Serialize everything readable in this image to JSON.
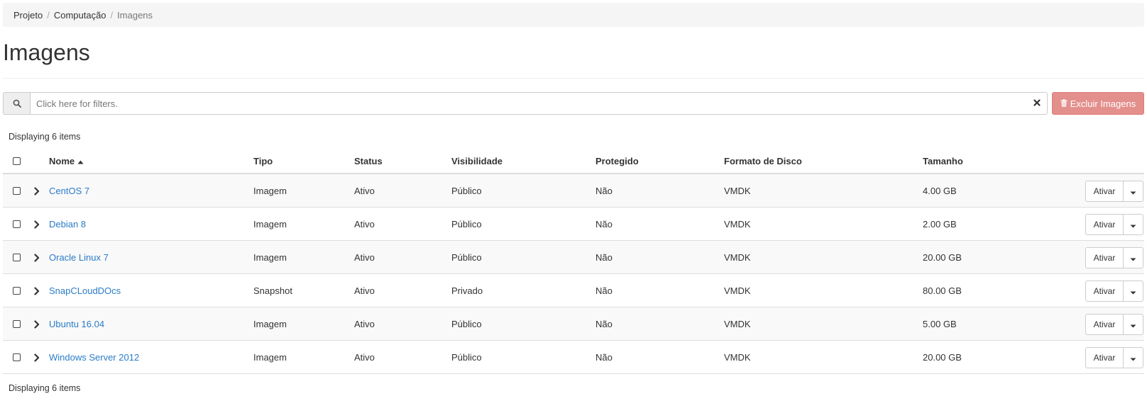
{
  "breadcrumb": {
    "items": [
      "Projeto",
      "Computação",
      "Imagens"
    ],
    "separator": "/"
  },
  "page": {
    "title": "Imagens"
  },
  "filter": {
    "placeholder": "Click here for filters."
  },
  "toolbar": {
    "delete_label": "Excluir Imagens"
  },
  "count_label": "Displaying 6 items",
  "table": {
    "columns": [
      "Nome",
      "Tipo",
      "Status",
      "Visibilidade",
      "Protegido",
      "Formato de Disco",
      "Tamanho"
    ],
    "action_label": "Ativar",
    "rows": [
      {
        "name": "CentOS 7",
        "type": "Imagem",
        "status": "Ativo",
        "visibility": "Público",
        "protected": "Não",
        "format": "VMDK",
        "size": "4.00 GB"
      },
      {
        "name": "Debian 8",
        "type": "Imagem",
        "status": "Ativo",
        "visibility": "Público",
        "protected": "Não",
        "format": "VMDK",
        "size": "2.00 GB"
      },
      {
        "name": "Oracle Linux 7",
        "type": "Imagem",
        "status": "Ativo",
        "visibility": "Público",
        "protected": "Não",
        "format": "VMDK",
        "size": "20.00 GB"
      },
      {
        "name": "SnapCLoudDOcs",
        "type": "Snapshot",
        "status": "Ativo",
        "visibility": "Privado",
        "protected": "Não",
        "format": "VMDK",
        "size": "80.00 GB"
      },
      {
        "name": "Ubuntu 16.04",
        "type": "Imagem",
        "status": "Ativo",
        "visibility": "Público",
        "protected": "Não",
        "format": "VMDK",
        "size": "5.00 GB"
      },
      {
        "name": "Windows Server 2012",
        "type": "Imagem",
        "status": "Ativo",
        "visibility": "Público",
        "protected": "Não",
        "format": "VMDK",
        "size": "20.00 GB"
      }
    ]
  },
  "colors": {
    "link": "#2a7cc7",
    "danger_button": "#e38f8c"
  },
  "icons": {
    "filter": "search-icon",
    "clear": "close-icon",
    "delete": "trash-icon",
    "expand": "chevron-right-icon",
    "dropdown": "caret-down-icon",
    "sort": "sort-asc-icon"
  }
}
